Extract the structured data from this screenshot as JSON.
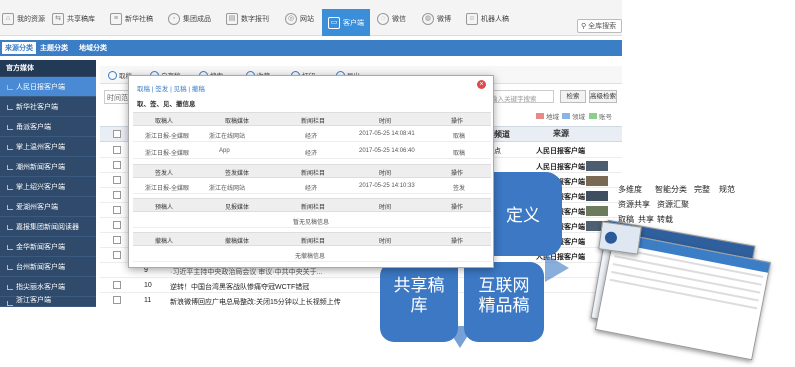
{
  "top_tabs": [
    {
      "label": "我的资源",
      "icon": "home-icon"
    },
    {
      "label": "共享稿库",
      "icon": "share-icon"
    },
    {
      "label": "新华社稿",
      "icon": "news-icon"
    },
    {
      "label": "集团成品",
      "icon": "group-icon"
    },
    {
      "label": "数字报刊",
      "icon": "newspaper-icon"
    },
    {
      "label": "网站",
      "icon": "globe-icon"
    },
    {
      "label": "客户端",
      "icon": "client-icon",
      "active": true
    },
    {
      "label": "微信",
      "icon": "wechat-icon"
    },
    {
      "label": "微博",
      "icon": "weibo-icon"
    },
    {
      "label": "机器人稿",
      "icon": "robot-icon"
    }
  ],
  "global_search": "全库搜索",
  "categories": [
    {
      "label": "来源分类",
      "active": true
    },
    {
      "label": "主题分类"
    },
    {
      "label": "地域分类"
    }
  ],
  "sidebar": {
    "heading": "官方媒体",
    "items": [
      "人民日报客户端",
      "新华社客户端",
      "甬派客户端",
      "掌上温州客户端",
      "潮州新闻客户端",
      "掌上绍兴客户端",
      "爱湖州客户端",
      "嘉报集团新闻阅读器",
      "金华新闻客户端",
      "台州新闻客户端",
      "指尖丽水客户端",
      "浙江客户端"
    ],
    "active_index": 0
  },
  "toolbar": {
    "buttons": [
      "取稿",
      "自存稿",
      "搜索",
      "收藏",
      "打印",
      "导出"
    ]
  },
  "filters": {
    "time_label": "时间范",
    "keyword_placeholder": "输入关键字搜索",
    "search_button": "检索",
    "advanced_button": "高级检索"
  },
  "legend": [
    {
      "label": "地域",
      "color": "#e88a8a"
    },
    {
      "label": "领域",
      "color": "#8ab4e8"
    },
    {
      "label": "账号",
      "color": "#8ad08a"
    }
  ],
  "table": {
    "headers": {
      "source": "来源",
      "category": "频道"
    },
    "rows": [
      {
        "num": "",
        "title": "点",
        "source": "人民日报客户端"
      },
      {
        "num": "",
        "title": "",
        "source": "人民日报客户端"
      },
      {
        "num": "",
        "title": "",
        "source": "人民日报客户端"
      },
      {
        "num": "",
        "title": "",
        "source": "人民日报客户端"
      },
      {
        "num": "",
        "title": "",
        "source": "人民日报客户端"
      },
      {
        "num": "",
        "title": "",
        "source": "人民日报客户端"
      },
      {
        "num": "",
        "title": "",
        "source": "人民日报客户端"
      },
      {
        "num": "9",
        "title": "·习近平主持中央政治局会议 审议·中共中央关于...",
        "source": "人民日报客户端"
      },
      {
        "num": "10",
        "title": "逆转！中国台湾黑客战队惨痛夺冠WCTF错冠",
        "source": ""
      },
      {
        "num": "11",
        "title": "新浪微博回应广电总局整改:关闭15分钟以上长视频上传",
        "source": ""
      }
    ]
  },
  "modal": {
    "tabs": "取稿 | 签发 | 见稿 | 撤稿",
    "subtitle": "取、签、见、撤信息",
    "sections": [
      {
        "headers": [
          "取稿人",
          "取稿媒体",
          "新闻栏目",
          "时间",
          "操作"
        ],
        "rows": [
          [
            "浙江日报-全媒眼",
            "浙江在线网站",
            "经济",
            "2017-05-25 14:08:41",
            "取稿"
          ],
          [
            "浙江日报-全媒眼",
            "App",
            "经济",
            "2017-05-25 14:06:40",
            "取稿"
          ]
        ]
      },
      {
        "headers": [
          "签发人",
          "签发媒体",
          "新闻栏目",
          "时间",
          "操作"
        ],
        "rows": [
          [
            "浙江日报-全媒眼",
            "浙江在线网站",
            "经济",
            "2017-05-25 14:10:33",
            "签发"
          ]
        ]
      },
      {
        "headers": [
          "预稿人",
          "见报媒体",
          "新闻栏目",
          "时间",
          "操作"
        ],
        "empty": "暂无见稿信息"
      },
      {
        "headers": [
          "撤稿人",
          "撤稿媒体",
          "新闻栏目",
          "时间",
          "操作"
        ],
        "empty": "无撤稿信息"
      }
    ]
  },
  "diagram": {
    "top_label": "定义",
    "left_label": "共享稿\n库",
    "right_label": "互联网\n精品稿",
    "color": "#3c78c4"
  },
  "features": [
    "多维度",
    "智能分类",
    "完整",
    "规范",
    "资源共享",
    "资源汇聚",
    "取稿",
    "共享",
    "转载"
  ]
}
